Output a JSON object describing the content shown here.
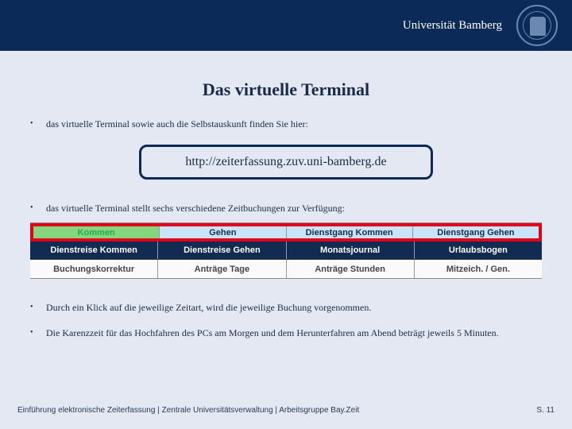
{
  "header": {
    "university": "Universität Bamberg"
  },
  "title": "Das virtuelle Terminal",
  "bullets": {
    "b1": "das virtuelle Terminal sowie auch die Selbstauskunft finden Sie hier:",
    "b2": "das virtuelle Terminal stellt sechs verschiedene Zeitbuchungen zur Verfügung:",
    "b3": "Durch ein Klick auf die jeweilige Zeitart, wird die jeweilige Buchung vorgenommen.",
    "b4": "Die Karenzzeit für das Hochfahren des PCs am Morgen und dem Herunterfahren am Abend beträgt jeweils 5 Minuten."
  },
  "url": "http://zeiterfassung.zuv.uni-bamberg.de",
  "table": {
    "r1": {
      "c1": "Kommen",
      "c2": "Gehen",
      "c3": "Dienstgang Kommen",
      "c4": "Dienstgang Gehen"
    },
    "r2": {
      "c1": "Dienstreise Kommen",
      "c2": "Dienstreise Gehen",
      "c3": "Monatsjournal",
      "c4": "Urlaubsbogen"
    },
    "r3": {
      "c1": "Buchungskorrektur",
      "c2": "Anträge Tage",
      "c3": "Anträge Stunden",
      "c4": "Mitzeich. / Gen."
    }
  },
  "footer": {
    "left": "Einführung elektronische Zeiterfassung | Zentrale Universitätsverwaltung | Arbeitsgruppe Bay.Zeit",
    "right": "S. 11"
  }
}
